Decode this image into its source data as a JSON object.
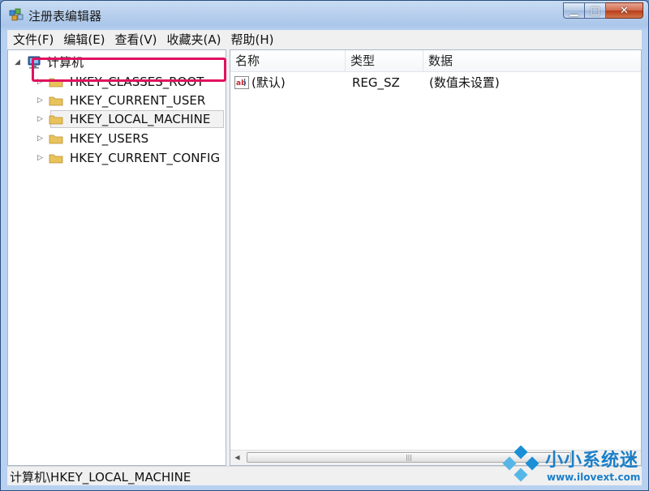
{
  "window": {
    "title": "注册表编辑器",
    "controls": {
      "minimize": "▁",
      "maximize": "□",
      "close": "✕"
    }
  },
  "menu": [
    "文件(F)",
    "编辑(E)",
    "查看(V)",
    "收藏夹(A)",
    "帮助(H)"
  ],
  "tree": {
    "root": "计算机",
    "items": [
      "HKEY_CLASSES_ROOT",
      "HKEY_CURRENT_USER",
      "HKEY_LOCAL_MACHINE",
      "HKEY_USERS",
      "HKEY_CURRENT_CONFIG"
    ],
    "selected": "HKEY_LOCAL_MACHINE"
  },
  "list": {
    "columns": [
      "名称",
      "类型",
      "数据"
    ],
    "rows": [
      {
        "name": "(默认)",
        "type": "REG_SZ",
        "data": "(数值未设置)"
      }
    ]
  },
  "status": "计算机\\HKEY_LOCAL_MACHINE",
  "watermark": {
    "name": "小小系统迷",
    "url": "www.ilovext.com"
  },
  "colors": {
    "highlight": "#e0115f",
    "folder": "#e8c25a",
    "accent": "#1a7fc9"
  }
}
